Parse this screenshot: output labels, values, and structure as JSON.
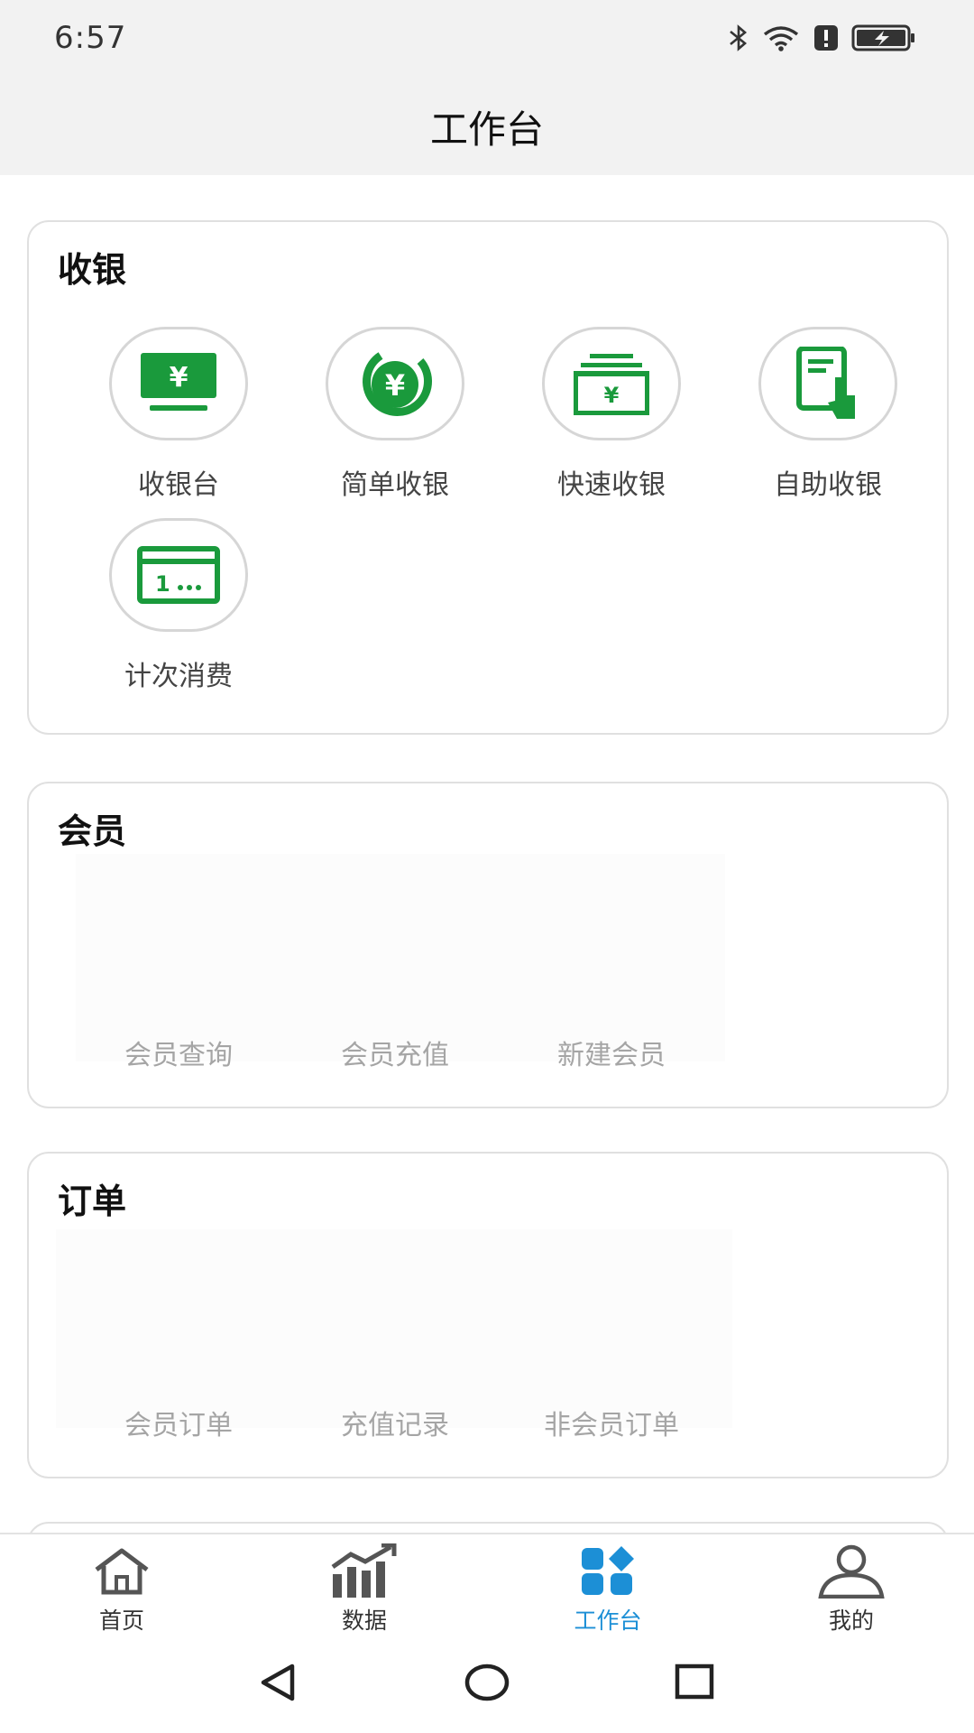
{
  "status_bar": {
    "time": "6:57",
    "icons": [
      "bluetooth-icon",
      "wifi-icon",
      "alert-icon",
      "battery-charging-icon"
    ]
  },
  "header": {
    "title": "工作台"
  },
  "accent_color": "#1a9a3c",
  "active_tab_color": "#1c8fd6",
  "sections": {
    "cashier": {
      "title": "收银",
      "items": [
        {
          "label": "收银台",
          "icon": "cashier-monitor-icon"
        },
        {
          "label": "简单收银",
          "icon": "yuan-coin-icon"
        },
        {
          "label": "快速收银",
          "icon": "cash-stack-icon"
        },
        {
          "label": "自助收银",
          "icon": "self-service-icon"
        },
        {
          "label": "计次消费",
          "icon": "count-card-icon"
        }
      ]
    },
    "member": {
      "title": "会员",
      "items": [
        {
          "label": "会员查询"
        },
        {
          "label": "会员充值"
        },
        {
          "label": "新建会员"
        }
      ]
    },
    "order": {
      "title": "订单",
      "items": [
        {
          "label": "会员订单"
        },
        {
          "label": "充值记录"
        },
        {
          "label": "非会员订单"
        }
      ]
    }
  },
  "tab_bar": {
    "tabs": [
      {
        "label": "首页",
        "icon": "home-icon"
      },
      {
        "label": "数据",
        "icon": "chart-icon"
      },
      {
        "label": "工作台",
        "icon": "workbench-icon",
        "active": true
      },
      {
        "label": "我的",
        "icon": "profile-icon"
      }
    ]
  },
  "nav_bar": {
    "buttons": [
      "back-icon",
      "home-circle-icon",
      "recents-icon"
    ]
  }
}
